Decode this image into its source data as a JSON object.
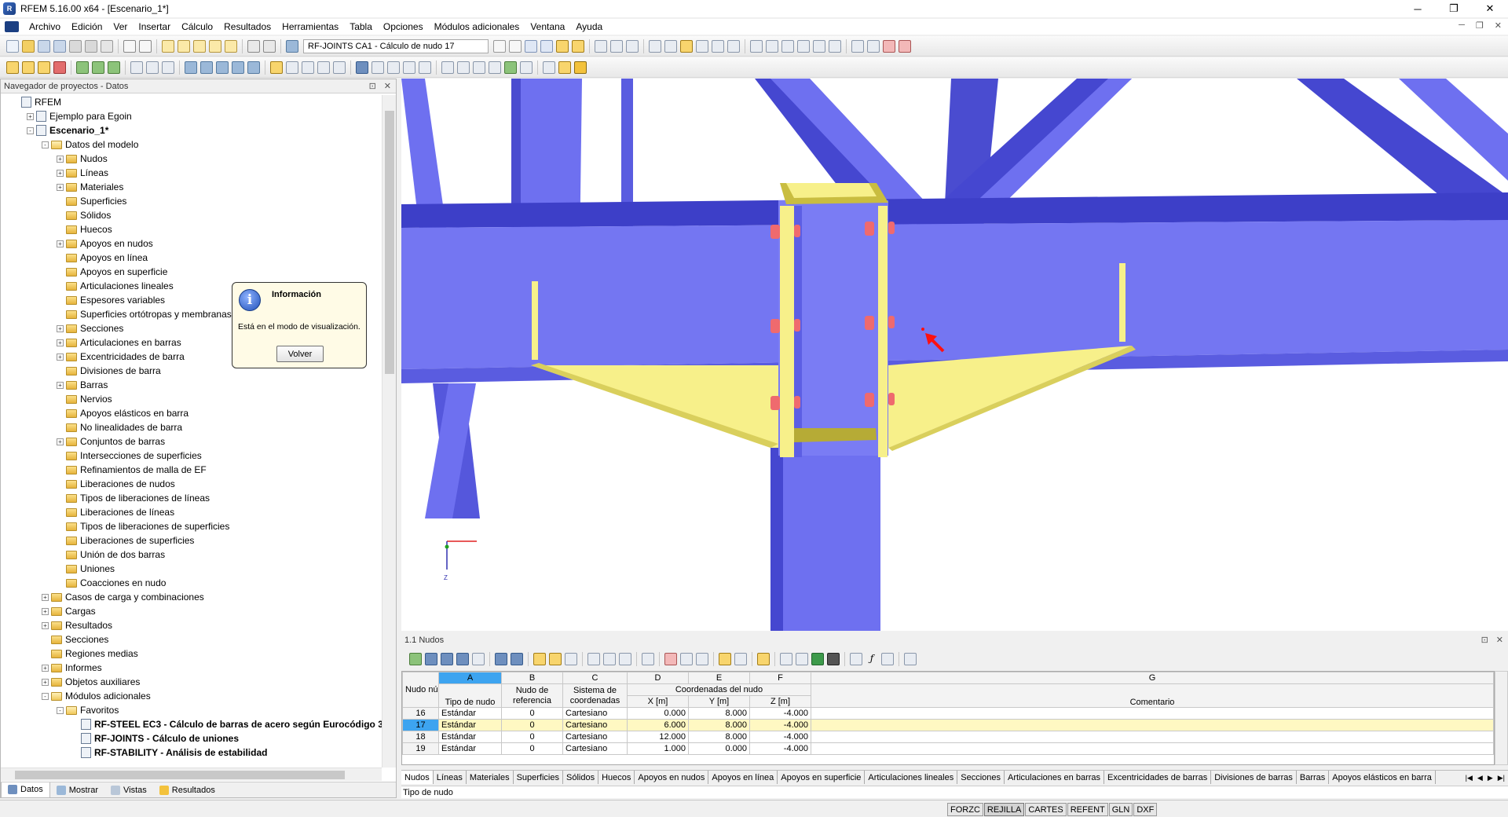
{
  "window": {
    "title": "RFEM 5.16.00 x64 - [Escenario_1*]",
    "app_icon": "rfem-logo-icon"
  },
  "menu": [
    "Archivo",
    "Edición",
    "Ver",
    "Insertar",
    "Cálculo",
    "Resultados",
    "Herramientas",
    "Tabla",
    "Opciones",
    "Módulos adicionales",
    "Ventana",
    "Ayuda"
  ],
  "toolbar": {
    "module_select": "RF-JOINTS CA1 - Cálculo de nudo 17"
  },
  "navigator": {
    "title": "Navegador de proyectos - Datos",
    "tree": [
      {
        "label": "RFEM",
        "level": 0,
        "icon": "rfem-icon",
        "exp": "none"
      },
      {
        "label": "Ejemplo para Egoin",
        "level": 1,
        "icon": "project-icon",
        "exp": "+"
      },
      {
        "label": "Escenario_1*",
        "level": 1,
        "icon": "project-icon",
        "exp": "-",
        "bold": true
      },
      {
        "label": "Datos del modelo",
        "level": 2,
        "icon": "folder-open-icon",
        "exp": "-"
      },
      {
        "label": "Nudos",
        "level": 3,
        "icon": "folder-icon",
        "exp": "+"
      },
      {
        "label": "Líneas",
        "level": 3,
        "icon": "folder-icon",
        "exp": "+"
      },
      {
        "label": "Materiales",
        "level": 3,
        "icon": "folder-icon",
        "exp": "+"
      },
      {
        "label": "Superficies",
        "level": 3,
        "icon": "folder-icon",
        "exp": "none"
      },
      {
        "label": "Sólidos",
        "level": 3,
        "icon": "folder-icon",
        "exp": "none"
      },
      {
        "label": "Huecos",
        "level": 3,
        "icon": "folder-icon",
        "exp": "none"
      },
      {
        "label": "Apoyos en nudos",
        "level": 3,
        "icon": "folder-icon",
        "exp": "+"
      },
      {
        "label": "Apoyos en línea",
        "level": 3,
        "icon": "folder-icon",
        "exp": "none"
      },
      {
        "label": "Apoyos en superficie",
        "level": 3,
        "icon": "folder-icon",
        "exp": "none"
      },
      {
        "label": "Articulaciones lineales",
        "level": 3,
        "icon": "folder-icon",
        "exp": "none"
      },
      {
        "label": "Espesores variables",
        "level": 3,
        "icon": "folder-icon",
        "exp": "none"
      },
      {
        "label": "Superficies ortótropas y membranas",
        "level": 3,
        "icon": "folder-icon",
        "exp": "none"
      },
      {
        "label": "Secciones",
        "level": 3,
        "icon": "folder-icon",
        "exp": "+"
      },
      {
        "label": "Articulaciones en barras",
        "level": 3,
        "icon": "folder-icon",
        "exp": "+"
      },
      {
        "label": "Excentricidades de barra",
        "level": 3,
        "icon": "folder-icon",
        "exp": "+"
      },
      {
        "label": "Divisiones de barra",
        "level": 3,
        "icon": "folder-icon",
        "exp": "none"
      },
      {
        "label": "Barras",
        "level": 3,
        "icon": "folder-icon",
        "exp": "+"
      },
      {
        "label": "Nervios",
        "level": 3,
        "icon": "folder-icon",
        "exp": "none"
      },
      {
        "label": "Apoyos elásticos en barra",
        "level": 3,
        "icon": "folder-icon",
        "exp": "none"
      },
      {
        "label": "No linealidades de barra",
        "level": 3,
        "icon": "folder-icon",
        "exp": "none"
      },
      {
        "label": "Conjuntos de barras",
        "level": 3,
        "icon": "folder-icon",
        "exp": "+"
      },
      {
        "label": "Intersecciones de superficies",
        "level": 3,
        "icon": "folder-icon",
        "exp": "none"
      },
      {
        "label": "Refinamientos de malla de EF",
        "level": 3,
        "icon": "folder-icon",
        "exp": "none"
      },
      {
        "label": "Liberaciones de nudos",
        "level": 3,
        "icon": "folder-icon",
        "exp": "none"
      },
      {
        "label": "Tipos de liberaciones de líneas",
        "level": 3,
        "icon": "folder-icon",
        "exp": "none"
      },
      {
        "label": "Liberaciones de líneas",
        "level": 3,
        "icon": "folder-icon",
        "exp": "none"
      },
      {
        "label": "Tipos de liberaciones de superficies",
        "level": 3,
        "icon": "folder-icon",
        "exp": "none"
      },
      {
        "label": "Liberaciones de superficies",
        "level": 3,
        "icon": "folder-icon",
        "exp": "none"
      },
      {
        "label": "Unión de dos barras",
        "level": 3,
        "icon": "folder-icon",
        "exp": "none"
      },
      {
        "label": "Uniones",
        "level": 3,
        "icon": "folder-icon",
        "exp": "none"
      },
      {
        "label": "Coacciones en nudo",
        "level": 3,
        "icon": "folder-icon",
        "exp": "none"
      },
      {
        "label": "Casos de carga y combinaciones",
        "level": 2,
        "icon": "folder-icon",
        "exp": "+"
      },
      {
        "label": "Cargas",
        "level": 2,
        "icon": "folder-icon",
        "exp": "+"
      },
      {
        "label": "Resultados",
        "level": 2,
        "icon": "folder-icon",
        "exp": "+"
      },
      {
        "label": "Secciones",
        "level": 2,
        "icon": "folder-icon",
        "exp": "none"
      },
      {
        "label": "Regiones medias",
        "level": 2,
        "icon": "folder-icon",
        "exp": "none"
      },
      {
        "label": "Informes",
        "level": 2,
        "icon": "folder-icon",
        "exp": "+"
      },
      {
        "label": "Objetos auxiliares",
        "level": 2,
        "icon": "folder-icon",
        "exp": "+"
      },
      {
        "label": "Módulos adicionales",
        "level": 2,
        "icon": "folder-open-icon",
        "exp": "-"
      },
      {
        "label": "Favoritos",
        "level": 3,
        "icon": "folder-open-icon",
        "exp": "-"
      },
      {
        "label": "RF-STEEL EC3 - Cálculo de barras de acero según Eurocódigo 3",
        "level": 4,
        "icon": "module-icon",
        "exp": "none",
        "bold": true
      },
      {
        "label": "RF-JOINTS - Cálculo de uniones",
        "level": 4,
        "icon": "module-icon",
        "exp": "none",
        "bold": true
      },
      {
        "label": "RF-STABILITY - Análisis de estabilidad",
        "level": 4,
        "icon": "module-icon",
        "exp": "none",
        "bold": true
      }
    ],
    "tabs": [
      {
        "label": "Datos",
        "icon": "data-icon",
        "active": true
      },
      {
        "label": "Mostrar",
        "icon": "display-icon",
        "active": false
      },
      {
        "label": "Vistas",
        "icon": "views-icon",
        "active": false
      },
      {
        "label": "Resultados",
        "icon": "results-icon",
        "active": false
      }
    ]
  },
  "info_dialog": {
    "title": "Información",
    "message": "Está en el modo de visualización.",
    "button": "Volver",
    "icon": "info-icon"
  },
  "axes": {
    "z": "Z"
  },
  "table": {
    "title": "1.1 Nudos",
    "col_letters": [
      "A",
      "B",
      "C",
      "D",
      "E",
      "F",
      "G"
    ],
    "rownum_header": "Nudo núm.",
    "headers": {
      "a": "Tipo de nudo",
      "b": "Nudo de referencia",
      "c": "Sistema de coordenadas",
      "group": "Coordenadas del nudo",
      "d": "X [m]",
      "e": "Y [m]",
      "f": "Z [m]",
      "g": "Comentario"
    },
    "rows": [
      {
        "no": "16",
        "type": "Estándar",
        "ref": "0",
        "sys": "Cartesiano",
        "x": "0.000",
        "y": "8.000",
        "z": "-4.000",
        "comment": ""
      },
      {
        "no": "17",
        "type": "Estándar",
        "ref": "0",
        "sys": "Cartesiano",
        "x": "6.000",
        "y": "8.000",
        "z": "-4.000",
        "comment": "",
        "selected": true
      },
      {
        "no": "18",
        "type": "Estándar",
        "ref": "0",
        "sys": "Cartesiano",
        "x": "12.000",
        "y": "8.000",
        "z": "-4.000",
        "comment": ""
      },
      {
        "no": "19",
        "type": "Estándar",
        "ref": "0",
        "sys": "Cartesiano",
        "x": "1.000",
        "y": "0.000",
        "z": "-4.000",
        "comment": ""
      }
    ],
    "tabs": [
      "Nudos",
      "Líneas",
      "Materiales",
      "Superficies",
      "Sólidos",
      "Huecos",
      "Apoyos en nudos",
      "Apoyos en línea",
      "Apoyos en superficie",
      "Articulaciones lineales",
      "Secciones",
      "Articulaciones en barras",
      "Excentricidades de barras",
      "Divisiones de barras",
      "Barras",
      "Apoyos elásticos en barra"
    ],
    "status": "Tipo de nudo"
  },
  "statusbar": {
    "buttons": [
      "FORZC",
      "REJILLA",
      "CARTES",
      "REFENT",
      "GLN",
      "DXF"
    ],
    "active": [
      "REJILLA"
    ]
  },
  "colors": {
    "beam_blue": "#6e70f0",
    "plate_yellow": "#f7f08a",
    "bolt_red": "#ef6a6e",
    "selection": "#3da4f0"
  }
}
